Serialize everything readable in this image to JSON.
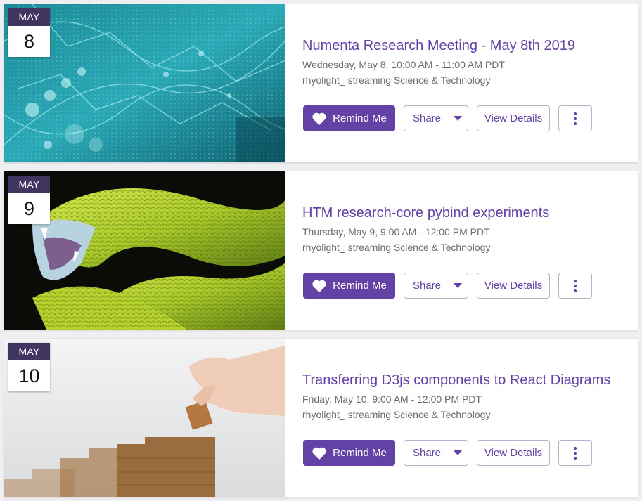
{
  "colors": {
    "accent": "#6441a5",
    "month_badge": "#3f3560",
    "meta_text": "#6b6b74"
  },
  "events": [
    {
      "month": "MAY",
      "day": "8",
      "title": "Numenta Research Meeting - May 8th 2019",
      "datetime": "Wednesday, May 8, 10:00 AM - 11:00 AM PDT",
      "channel": "rhyolight_ streaming Science & Technology",
      "remind_label": "Remind Me",
      "share_label": "Share",
      "details_label": "View Details",
      "thumbnail": "dna-network-image"
    },
    {
      "month": "MAY",
      "day": "9",
      "title": "HTM research-core pybind experiments",
      "datetime": "Thursday, May 9, 9:00 AM - 12:00 PM PDT",
      "channel": "rhyolight_ streaming Science & Technology",
      "remind_label": "Remind Me",
      "share_label": "Share",
      "details_label": "View Details",
      "thumbnail": "green-viper-image"
    },
    {
      "month": "MAY",
      "day": "10",
      "title": "Transferring D3js components to React Diagrams",
      "datetime": "Friday, May 10, 9:00 AM - 12:00 PM PDT",
      "channel": "rhyolight_ streaming Science & Technology",
      "remind_label": "Remind Me",
      "share_label": "Share",
      "details_label": "View Details",
      "thumbnail": "wooden-blocks-stairs-image"
    }
  ]
}
